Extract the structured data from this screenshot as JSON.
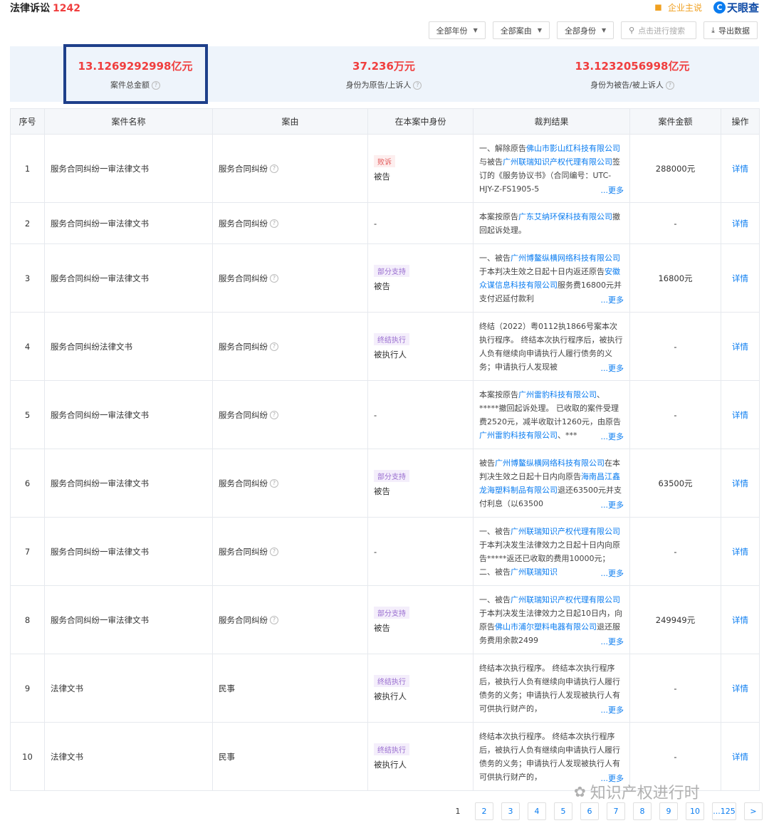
{
  "header": {
    "title": "法律诉讼",
    "count": "1242",
    "ent_label": "企业主说",
    "brand": "天眼查"
  },
  "toolbar": {
    "year": "全部年份",
    "cause": "全部案由",
    "role": "全部身份",
    "search_placeholder": "点击进行搜索",
    "export": "导出数据"
  },
  "summary": [
    {
      "value": "13.1269292998亿元",
      "label": "案件总金额"
    },
    {
      "value": "37.236万元",
      "label": "身份为原告/上诉人"
    },
    {
      "value": "13.1232056998亿元",
      "label": "身份为被告/被上诉人"
    }
  ],
  "table": {
    "headers": [
      "序号",
      "案件名称",
      "案由",
      "在本案中身份",
      "裁判结果",
      "案件金额",
      "操作"
    ],
    "rows": [
      {
        "no": "1",
        "name": "服务合同纠纷一审法律文书",
        "cause": "服务合同纠纷",
        "tag": "败诉",
        "role": "被告",
        "result": [
          {
            "t": "一、解除原告"
          },
          {
            "t": "佛山市影山红科技有限公司",
            "l": true
          },
          {
            "t": "与被告"
          },
          {
            "t": "广州联瑞知识产权代理有限公司",
            "l": true
          },
          {
            "t": "签订的《服务协议书》（合同编号：UTC-HJY-Z-FS1905-5"
          }
        ],
        "amount": "288000元",
        "action": "详情"
      },
      {
        "no": "2",
        "name": "服务合同纠纷一审法律文书",
        "cause": "服务合同纠纷",
        "tag": "",
        "role": "-",
        "result": [
          {
            "t": "本案按原告"
          },
          {
            "t": "广东艾纳环保科技有限公司",
            "l": true
          },
          {
            "t": "撤回起诉处理。"
          }
        ],
        "amount": "-",
        "action": "详情"
      },
      {
        "no": "3",
        "name": "服务合同纠纷一审法律文书",
        "cause": "服务合同纠纷",
        "tag": "部分支持",
        "role": "被告",
        "result": [
          {
            "t": "一、被告"
          },
          {
            "t": "广州博鳌纵横网络科技有限公司",
            "l": true
          },
          {
            "t": "于本判决生效之日起十日内返还原告"
          },
          {
            "t": "安徽众谋信息科技有限公司",
            "l": true
          },
          {
            "t": "服务费16800元并支付迟延付款利"
          }
        ],
        "amount": "16800元",
        "action": "详情"
      },
      {
        "no": "4",
        "name": "服务合同纠纷法律文书",
        "cause": "服务合同纠纷",
        "tag": "终结执行",
        "role": "被执行人",
        "result": [
          {
            "t": "终结（2022）粤0112执1866号案本次执行程序。 终结本次执行程序后，被执行人负有继续向申请执行人履行债务的义务；申请执行人发现被"
          }
        ],
        "amount": "-",
        "action": "详情"
      },
      {
        "no": "5",
        "name": "服务合同纠纷一审法律文书",
        "cause": "服务合同纠纷",
        "tag": "",
        "role": "-",
        "result": [
          {
            "t": "本案按原告"
          },
          {
            "t": "广州雷豹科技有限公司",
            "l": true
          },
          {
            "t": "、*****撤回起诉处理。 已收取的案件受理费2520元，减半收取计1260元，由原告"
          },
          {
            "t": "广州雷豹科技有限公司",
            "l": true
          },
          {
            "t": "、***"
          }
        ],
        "amount": "-",
        "action": "详情"
      },
      {
        "no": "6",
        "name": "服务合同纠纷一审法律文书",
        "cause": "服务合同纠纷",
        "tag": "部分支持",
        "role": "被告",
        "result": [
          {
            "t": "被告"
          },
          {
            "t": "广州博鳌纵横网络科技有限公司",
            "l": true
          },
          {
            "t": "在本判决生效之日起十日内向原告"
          },
          {
            "t": "海南昌江鑫龙海塑料制品有限公司",
            "l": true
          },
          {
            "t": "退还63500元并支付利息（以63500"
          }
        ],
        "amount": "63500元",
        "action": "详情"
      },
      {
        "no": "7",
        "name": "服务合同纠纷一审法律文书",
        "cause": "服务合同纠纷",
        "tag": "",
        "role": "-",
        "result": [
          {
            "t": "一、被告"
          },
          {
            "t": "广州联瑞知识产权代理有限公司",
            "l": true
          },
          {
            "t": "于本判决发生法律效力之日起十日内向原告*****返还已收取的费用10000元； 二、被告"
          },
          {
            "t": "广州联瑞知识",
            "l": true
          }
        ],
        "amount": "-",
        "action": "详情"
      },
      {
        "no": "8",
        "name": "服务合同纠纷一审法律文书",
        "cause": "服务合同纠纷",
        "tag": "部分支持",
        "role": "被告",
        "result": [
          {
            "t": "一、被告"
          },
          {
            "t": "广州联瑞知识产权代理有限公司",
            "l": true
          },
          {
            "t": "于本判决发生法律效力之日起10日内，向原告"
          },
          {
            "t": "佛山市浦尔塑料电器有限公司",
            "l": true
          },
          {
            "t": "退还服务费用余款2499"
          }
        ],
        "amount": "249949元",
        "action": "详情"
      },
      {
        "no": "9",
        "name": "法律文书",
        "cause": "民事",
        "tag": "终结执行",
        "role": "被执行人",
        "result": [
          {
            "t": "终结本次执行程序。 终结本次执行程序后，被执行人负有继续向申请执行人履行债务的义务；申请执行人发现被执行人有可供执行财产的，"
          }
        ],
        "amount": "-",
        "action": "详情"
      },
      {
        "no": "10",
        "name": "法律文书",
        "cause": "民事",
        "tag": "终结执行",
        "role": "被执行人",
        "result": [
          {
            "t": "终结本次执行程序。 终结本次执行程序后，被执行人负有继续向申请执行人履行债务的义务；申请执行人发现被执行人有可供执行财产的，"
          }
        ],
        "amount": "-",
        "action": "详情"
      }
    ],
    "more_label": "...更多"
  },
  "pager": [
    "1",
    "2",
    "3",
    "4",
    "5",
    "6",
    "7",
    "8",
    "9",
    "10",
    "...125",
    ">"
  ],
  "watermark": "知识产权进行时"
}
